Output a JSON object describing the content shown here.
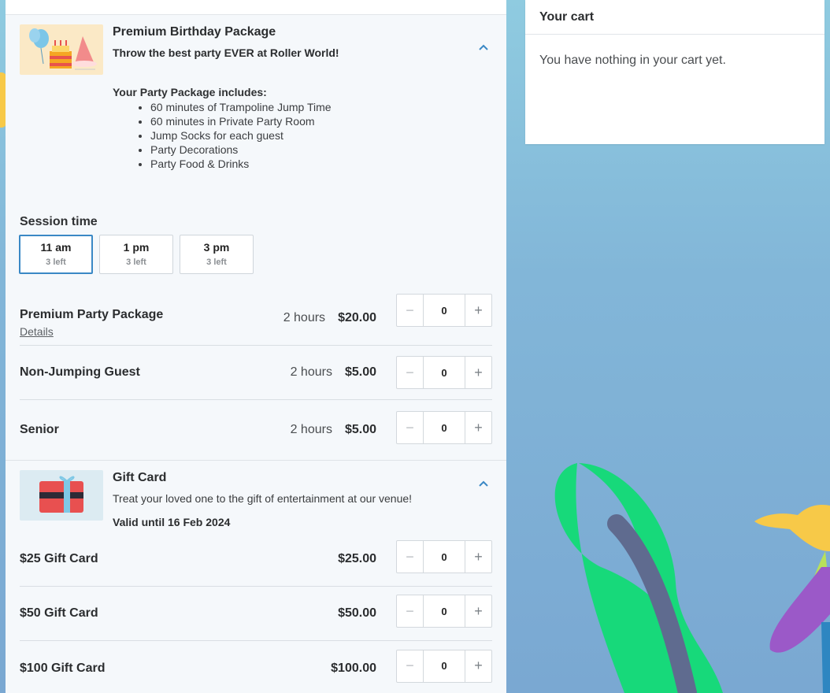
{
  "birthday": {
    "title": "Premium Birthday Package",
    "tagline": "Throw the best party EVER at Roller World!",
    "includes_title": "Your Party Package includes:",
    "includes": [
      "60 minutes of Trampoline Jump Time",
      "60 minutes in Private Party Room",
      "Jump Socks for each guest",
      "Party Decorations",
      "Party Food & Drinks"
    ],
    "session_label": "Session time",
    "sessions": [
      {
        "time": "11 am",
        "left": "3 left",
        "selected": true
      },
      {
        "time": "1 pm",
        "left": "3 left",
        "selected": false
      },
      {
        "time": "3 pm",
        "left": "3 left",
        "selected": false
      }
    ],
    "items": [
      {
        "name": "Premium Party Package",
        "details": "Details",
        "duration": "2 hours",
        "price": "$20.00",
        "qty": "0"
      },
      {
        "name": "Non-Jumping Guest",
        "duration": "2 hours",
        "price": "$5.00",
        "qty": "0"
      },
      {
        "name": "Senior",
        "duration": "2 hours",
        "price": "$5.00",
        "qty": "0"
      }
    ]
  },
  "giftcard": {
    "title": "Gift Card",
    "description": "Treat your loved one to the gift of entertainment at our venue!",
    "valid": "Valid until 16 Feb 2024",
    "items": [
      {
        "name": "$25 Gift Card",
        "price": "$25.00",
        "qty": "0"
      },
      {
        "name": "$50 Gift Card",
        "price": "$50.00",
        "qty": "0"
      },
      {
        "name": "$100 Gift Card",
        "price": "$100.00",
        "qty": "0"
      }
    ]
  },
  "stepper": {
    "minus": "−",
    "plus": "+"
  },
  "cart": {
    "title": "Your cart",
    "empty_message": "You have nothing in your cart yet."
  },
  "colors": {
    "accent": "#3a88c5",
    "panel_bg": "#f5f8fb",
    "page_bg": "#82b6d8"
  }
}
